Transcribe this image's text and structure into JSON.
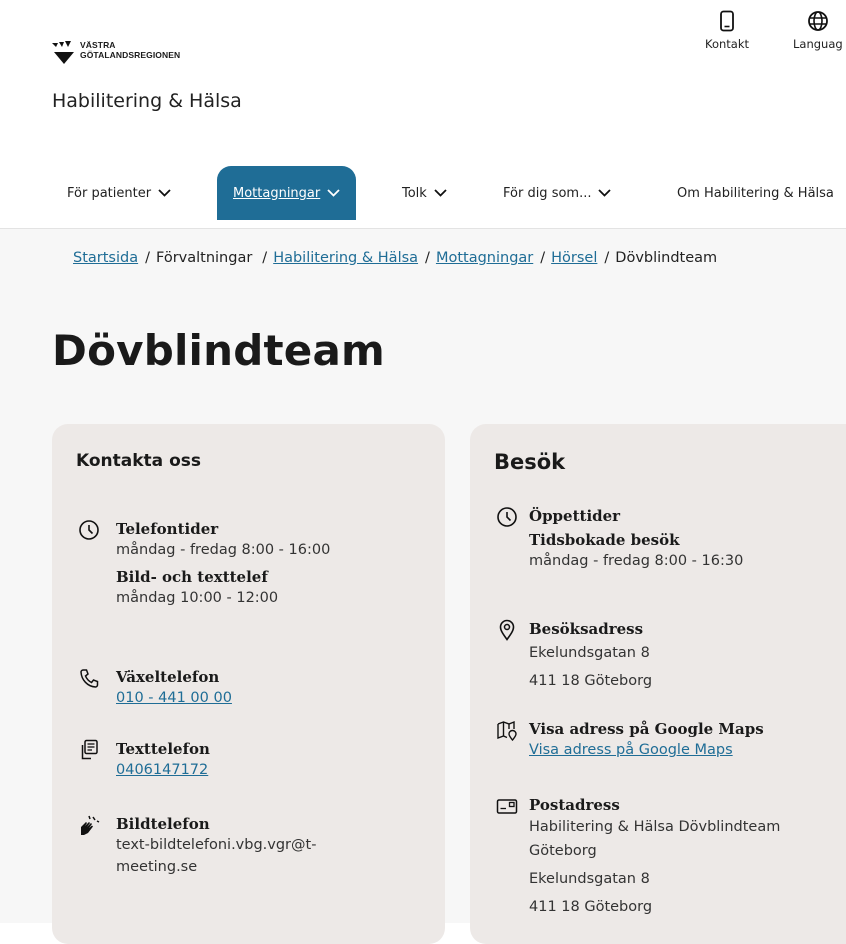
{
  "header": {
    "logo_line1": "VÄSTRA",
    "logo_line2": "GÖTALANDSREGIONEN",
    "org_name": "Habilitering & Hälsa",
    "contact_label": "Kontakt",
    "language_label": "Languag"
  },
  "nav": {
    "items": [
      {
        "label": "För patienter"
      },
      {
        "label": "Mottagningar"
      },
      {
        "label": "Tolk"
      },
      {
        "label": "För dig som..."
      },
      {
        "label": "Om Habilitering & Hälsa"
      }
    ]
  },
  "breadcrumb": {
    "items": [
      "Startsida",
      "Förvaltningar",
      "Habilitering & Hälsa",
      "Mottagningar",
      "Hörsel",
      "Dövblindteam"
    ],
    "separator": "/"
  },
  "page": {
    "title": "Dövblindteam"
  },
  "contact_card": {
    "title": "Kontakta oss",
    "phone_hours_heading": "Telefontider",
    "phone_hours_text": "måndag - fredag 8:00 - 16:00",
    "textphone_hours_heading": "Bild- och texttelef",
    "textphone_hours_text": "måndag 10:00 - 12:00",
    "switchboard_heading": "Växeltelefon",
    "switchboard_number": "010 - 441 00 00",
    "textphone_heading": "Texttelefon",
    "textphone_number": "0406147172",
    "videophone_heading": "Bildtelefon",
    "videophone_line1": "text-bildtelefoni.vbg.vgr@t-",
    "videophone_line2": "meeting.se"
  },
  "visit_card": {
    "title": "Besök",
    "opening_heading": "Öppettider",
    "opening_subheading": "Tidsbokade besök",
    "opening_text": "måndag - fredag 8:00 - 16:30",
    "visit_address_heading": "Besöksadress",
    "visit_address_line1": "Ekelundsgatan 8",
    "visit_address_line2": "411 18 Göteborg",
    "maps_heading": "Visa adress på Google Maps",
    "maps_link": "Visa adress på Google Maps",
    "postal_heading": "Postadress",
    "postal_line1": "Habilitering & Hälsa Dövblindteam",
    "postal_line2": "Göteborg",
    "postal_line3": "Ekelundsgatan 8",
    "postal_line4": "411 18 Göteborg"
  },
  "colors": {
    "accent": "#1f6d96",
    "card_bg": "#ede9e7",
    "page_bg": "#f7f7f7"
  },
  "icons": [
    "vgr-logo-icon",
    "mobile-phone-icon",
    "globe-icon",
    "chevron-down-icon",
    "clock-icon",
    "phone-icon",
    "textphone-icon",
    "sign-language-icon",
    "location-pin-icon",
    "map-icon",
    "mailbox-icon"
  ]
}
